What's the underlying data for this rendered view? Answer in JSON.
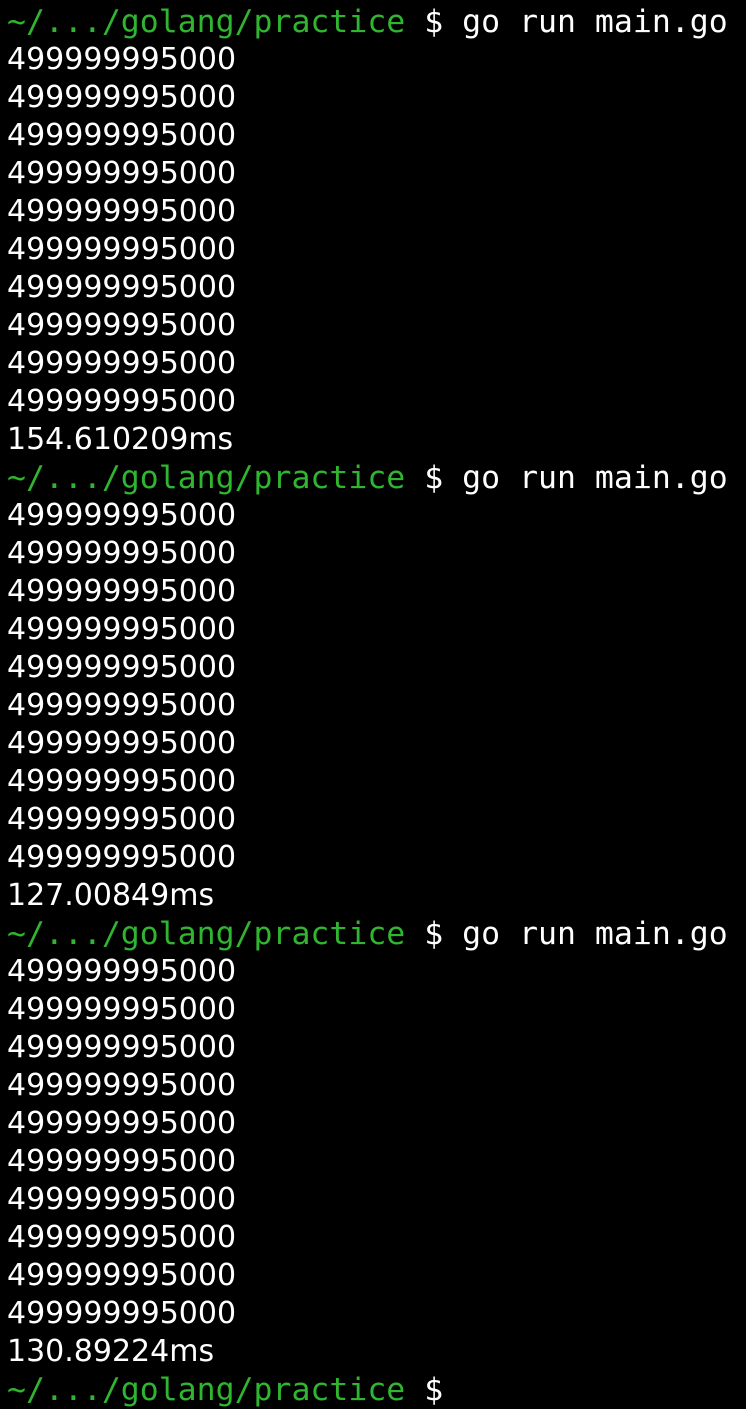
{
  "theme": {
    "background": "#000000",
    "prompt_path_color": "#2fb52f",
    "text_color": "#ffffff"
  },
  "prompt": {
    "path": "~/.../golang/practice",
    "symbol": "$"
  },
  "sessions": [
    {
      "command": "go run main.go",
      "output": [
        "499999995000",
        "499999995000",
        "499999995000",
        "499999995000",
        "499999995000",
        "499999995000",
        "499999995000",
        "499999995000",
        "499999995000",
        "499999995000"
      ],
      "elapsed": "154.610209ms"
    },
    {
      "command": "go run main.go",
      "output": [
        "499999995000",
        "499999995000",
        "499999995000",
        "499999995000",
        "499999995000",
        "499999995000",
        "499999995000",
        "499999995000",
        "499999995000",
        "499999995000"
      ],
      "elapsed": "127.00849ms"
    },
    {
      "command": "go run main.go",
      "output": [
        "499999995000",
        "499999995000",
        "499999995000",
        "499999995000",
        "499999995000",
        "499999995000",
        "499999995000",
        "499999995000",
        "499999995000",
        "499999995000"
      ],
      "elapsed": "130.89224ms"
    }
  ],
  "trailing_prompt": {
    "path": "~/.../golang/practice",
    "symbol": "$"
  }
}
